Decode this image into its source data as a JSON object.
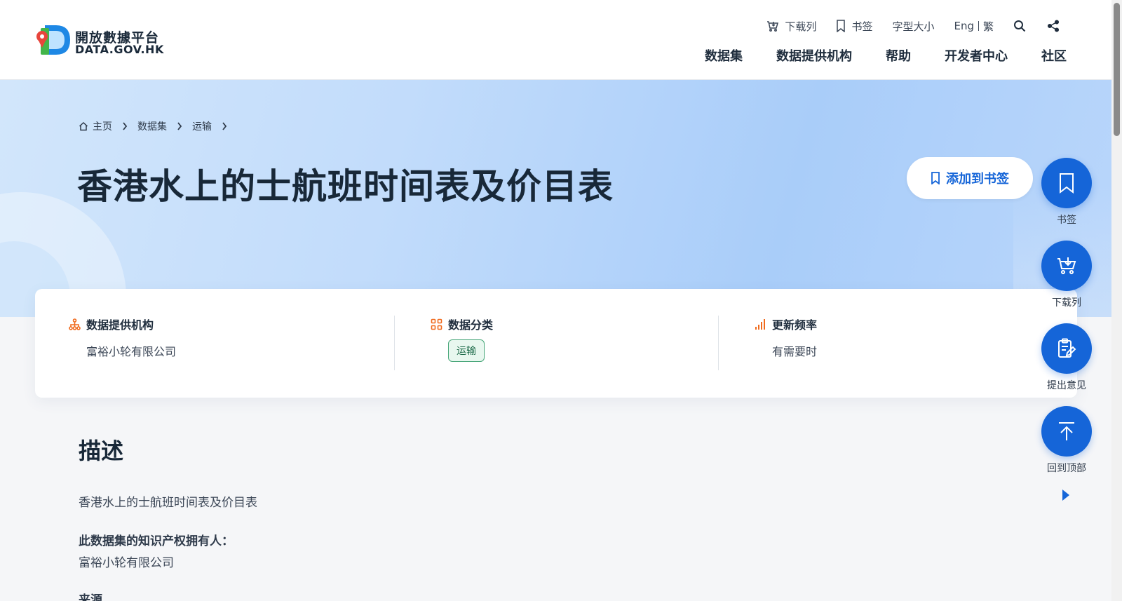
{
  "header": {
    "logo": {
      "line1": "開放數據平台",
      "line2": "DATA.GOV.HK"
    },
    "utility": {
      "download_list": "下载列",
      "bookmarks": "书签",
      "font_size": "字型大小",
      "lang_en": "Eng",
      "lang_tc": "繁"
    },
    "nav": [
      "数据集",
      "数据提供机构",
      "帮助",
      "开发者中心",
      "社区"
    ]
  },
  "breadcrumb": [
    "主页",
    "数据集",
    "运输"
  ],
  "page_title": "香港水上的士航班时间表及价目表",
  "add_bookmark_label": "添加到书签",
  "info_card": {
    "provider_label": "数据提供机构",
    "provider_value": "富裕小轮有限公司",
    "category_label": "数据分类",
    "category_value": "运输",
    "frequency_label": "更新频率",
    "frequency_value": "有需要时"
  },
  "description": {
    "heading": "描述",
    "text": "香港水上的士航班时间表及价目表",
    "ip_owner_label": "此数据集的知识产权拥有人：",
    "ip_owner_value": "富裕小轮有限公司",
    "source_label": "来源"
  },
  "fabs": [
    "书签",
    "下载列",
    "提出意见",
    "回到顶部"
  ],
  "colors": {
    "primary": "#1565d8",
    "accent_orange": "#f06a1d",
    "tag_green": "#49a77a"
  }
}
